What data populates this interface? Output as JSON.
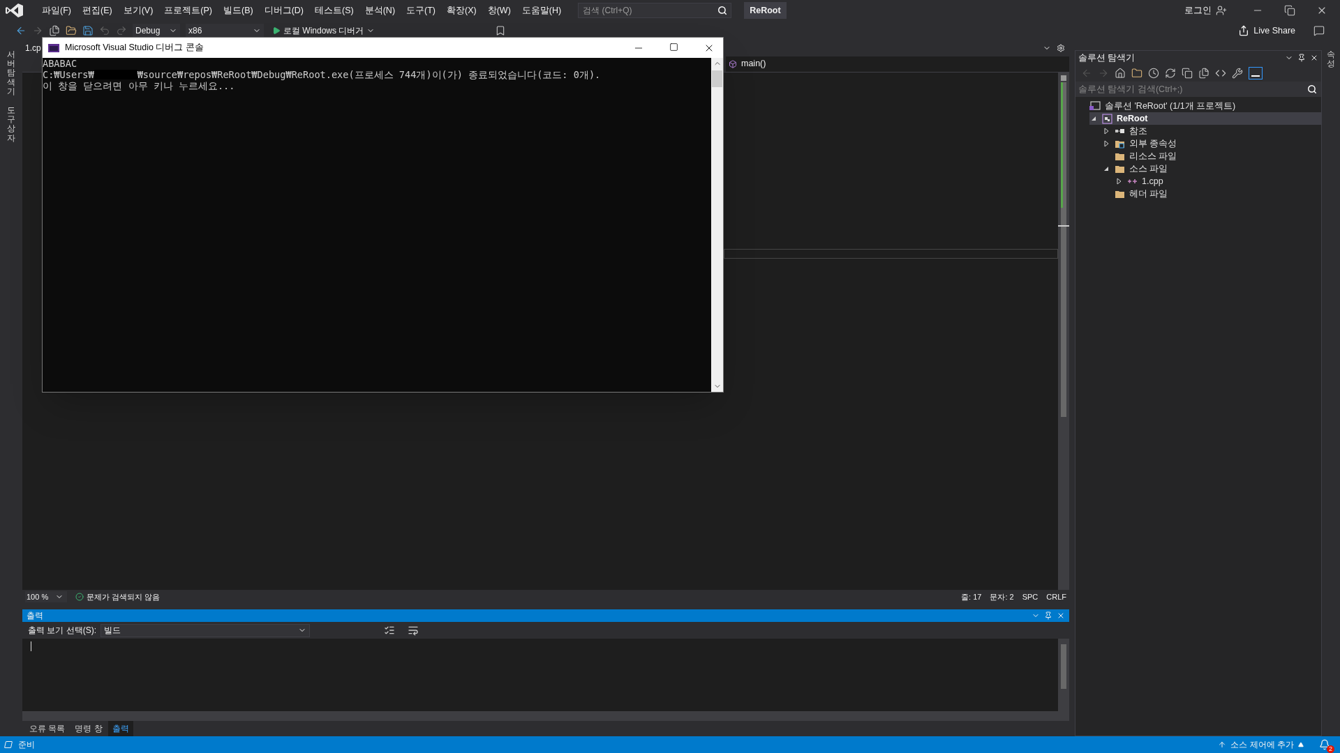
{
  "title_bar": {
    "menu": [
      "파일(F)",
      "편집(E)",
      "보기(V)",
      "프로젝트(P)",
      "빌드(B)",
      "디버그(D)",
      "테스트(S)",
      "분석(N)",
      "도구(T)",
      "확장(X)",
      "창(W)",
      "도움말(H)"
    ],
    "search": {
      "placeholder": "검색 (Ctrl+Q)"
    },
    "solution_name": "ReRoot",
    "login": "로그인"
  },
  "toolbar": {
    "configuration": "Debug",
    "platform": "x86",
    "run_label": "로컬 Windows 디버거",
    "live_share": "Live Share"
  },
  "side_tabs_left": [
    "서버 탐색기",
    "도구 상자"
  ],
  "side_tabs_right": [
    "속성"
  ],
  "editor": {
    "tab": "1.cp",
    "member_dropdown": "main()",
    "status": {
      "zoom": "100 %",
      "issues": "문제가 검색되지 않음",
      "line": "줄: 17",
      "column": "문자: 2",
      "whitespace": "SPC",
      "line_ending": "CRLF"
    }
  },
  "console": {
    "title": "Microsoft Visual Studio 디버그 콘솔",
    "lines": [
      [
        {
          "kind": "text",
          "text": "ABABAC"
        }
      ],
      [
        {
          "kind": "text",
          "text": "C:₩Users₩"
        },
        {
          "kind": "redaction"
        },
        {
          "kind": "text",
          "text": "₩source₩repos₩ReRoot₩Debug₩ReRoot.exe(프로세스 744개)이(가) 종료되었습니다(코드: 0개)."
        }
      ],
      [
        {
          "kind": "text",
          "text": "이 창을 닫으려면 아무 키나 누르세요..."
        }
      ]
    ]
  },
  "output": {
    "title": "출력",
    "source_label": "출력 보기 선택(S):",
    "source": "빌드",
    "tabs": [
      {
        "label": "오류 목록",
        "selected": false
      },
      {
        "label": "명령 창",
        "selected": false
      },
      {
        "label": "출력",
        "selected": true
      }
    ]
  },
  "solution_explorer": {
    "title": "솔루션 탐색기",
    "search": {
      "placeholder": "솔루션 탐색기 검색(Ctrl+;)"
    },
    "tree": [
      {
        "label": "솔루션 'ReRoot' (1/1개 프로젝트)",
        "kind": "solution",
        "selected": false,
        "children": [
          {
            "label": "ReRoot",
            "kind": "project",
            "selected": true,
            "expanded": true,
            "children": [
              {
                "label": "참조",
                "kind": "references",
                "selected": false,
                "expanded": false
              },
              {
                "label": "외부 종속성",
                "kind": "external",
                "selected": false,
                "expanded": false
              },
              {
                "label": "리소스 파일",
                "kind": "folder",
                "selected": false
              },
              {
                "label": "소스 파일",
                "kind": "folder",
                "selected": false,
                "expanded": true,
                "children": [
                  {
                    "label": "1.cpp",
                    "kind": "cpp",
                    "selected": false,
                    "expanded": false
                  }
                ]
              },
              {
                "label": "헤더 파일",
                "kind": "folder",
                "selected": false
              }
            ]
          }
        ]
      }
    ]
  },
  "status_bar": {
    "state": "준비",
    "source_control": "소스 제어에 추가",
    "notifications": "2"
  }
}
